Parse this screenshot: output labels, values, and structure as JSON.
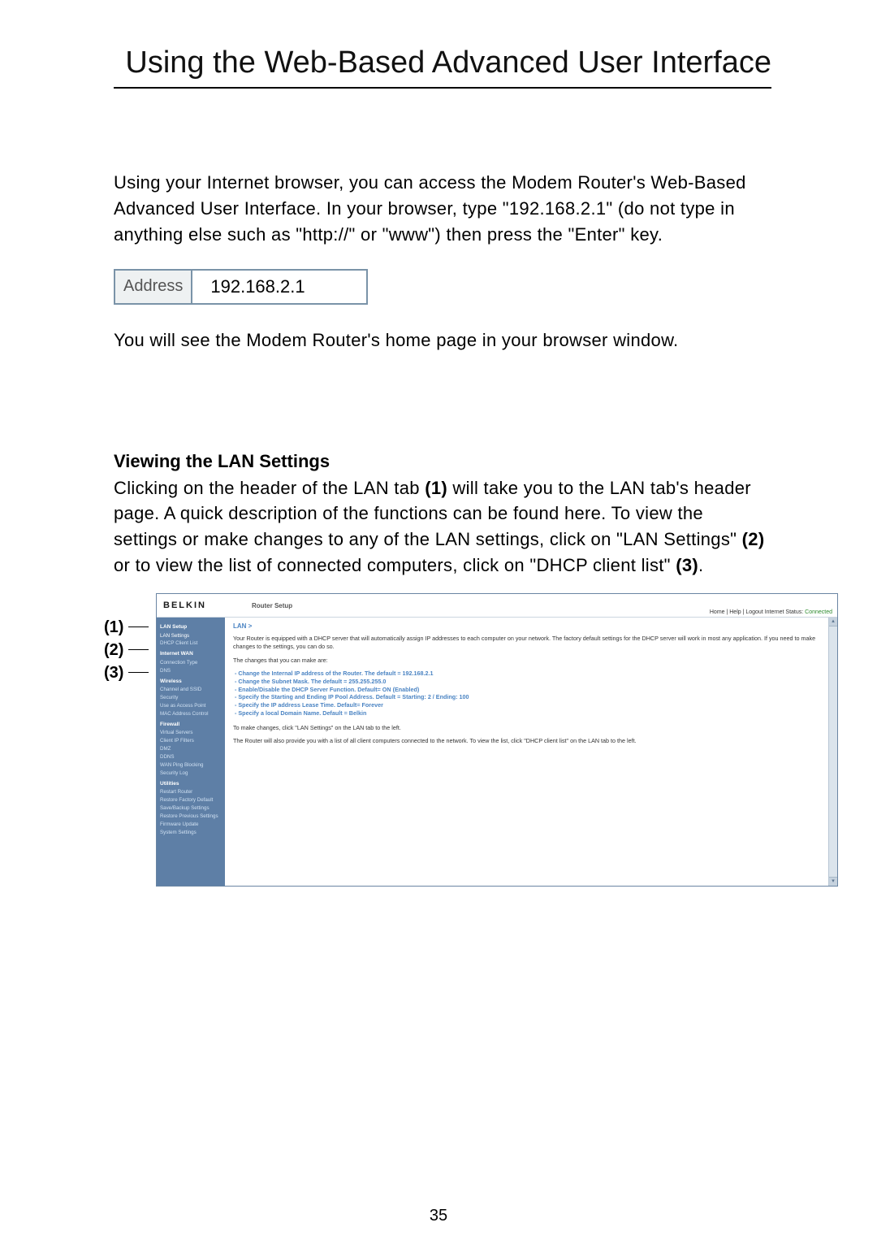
{
  "title": "Using the Web-Based Advanced User Interface",
  "intro": "Using your Internet browser, you can access the Modem Router's Web-Based Advanced User Interface. In your browser, type \"192.168.2.1\" (do not type in anything else such as \"http://\" or \"www\") then press the \"Enter\" key.",
  "addr": {
    "label": "Address",
    "value": "192.168.2.1"
  },
  "after_addr": "You will see the Modem Router's home page in your browser window.",
  "section_heading": "Viewing the LAN Settings",
  "section_body_pre": "Clicking on the header of the LAN tab ",
  "section_body_1": "(1)",
  "section_body_mid1": " will take you to the LAN tab's header page. A quick description of the functions can be found here. To view the settings or make changes to any of the LAN settings, click on \"LAN Settings\" ",
  "section_body_2": "(2)",
  "section_body_mid2": " or to view the list of connected computers, click on \"DHCP client list\" ",
  "section_body_3": "(3)",
  "section_body_end": ".",
  "callouts": {
    "c1": "(1)",
    "c2": "(2)",
    "c3": "(3)"
  },
  "shot": {
    "brand": "BELKIN",
    "sub": "Router Setup",
    "toplinks_a": "Home | Help | Logout   Internet Status: ",
    "toplinks_b": "Connected",
    "crumb": "LAN >",
    "p1": "Your Router is equipped with a DHCP server that will automatically assign IP addresses to each computer on your network. The factory default settings for the DHCP server will work in most any application. If you need to make changes to the settings, you can do so.",
    "p2": "The changes that you can make are:",
    "bullets": [
      "- Change the Internal IP address of the Router. The default = 192.168.2.1",
      "- Change the Subnet Mask. The default = 255.255.255.0",
      "- Enable/Disable the DHCP Server Function. Default= ON (Enabled)",
      "- Specify the Starting and Ending IP Pool Address. Default = Starting: 2 / Ending: 100",
      "- Specify the IP address Lease Time. Default= Forever",
      "- Specify a local Domain Name. Default = Belkin"
    ],
    "p3": "To make changes, click \"LAN Settings\" on the LAN tab to the left.",
    "p4": "The Router will also provide you with a list of all client computers connected to the network. To view the list, click \"DHCP client list\" on the LAN tab to the left.",
    "sidebar": {
      "s1h": "LAN Setup",
      "s1a": "LAN Settings",
      "s1b": "DHCP Client List",
      "s2h": "Internet WAN",
      "s2a": "Connection Type",
      "s2b": "DNS",
      "s3h": "Wireless",
      "s3a": "Channel and SSID",
      "s3b": "Security",
      "s3c": "Use as Access Point",
      "s3d": "MAC Address Control",
      "s4h": "Firewall",
      "s4a": "Virtual Servers",
      "s4b": "Client IP Filters",
      "s4c": "DMZ",
      "s4d": "DDNS",
      "s4e": "WAN Ping Blocking",
      "s4f": "Security Log",
      "s5h": "Utilities",
      "s5a": "Restart Router",
      "s5b": "Restore Factory Default",
      "s5c": "Save/Backup Settings",
      "s5d": "Restore Previous Settings",
      "s5e": "Firmware Update",
      "s5f": "System Settings"
    }
  },
  "page_num": "35"
}
